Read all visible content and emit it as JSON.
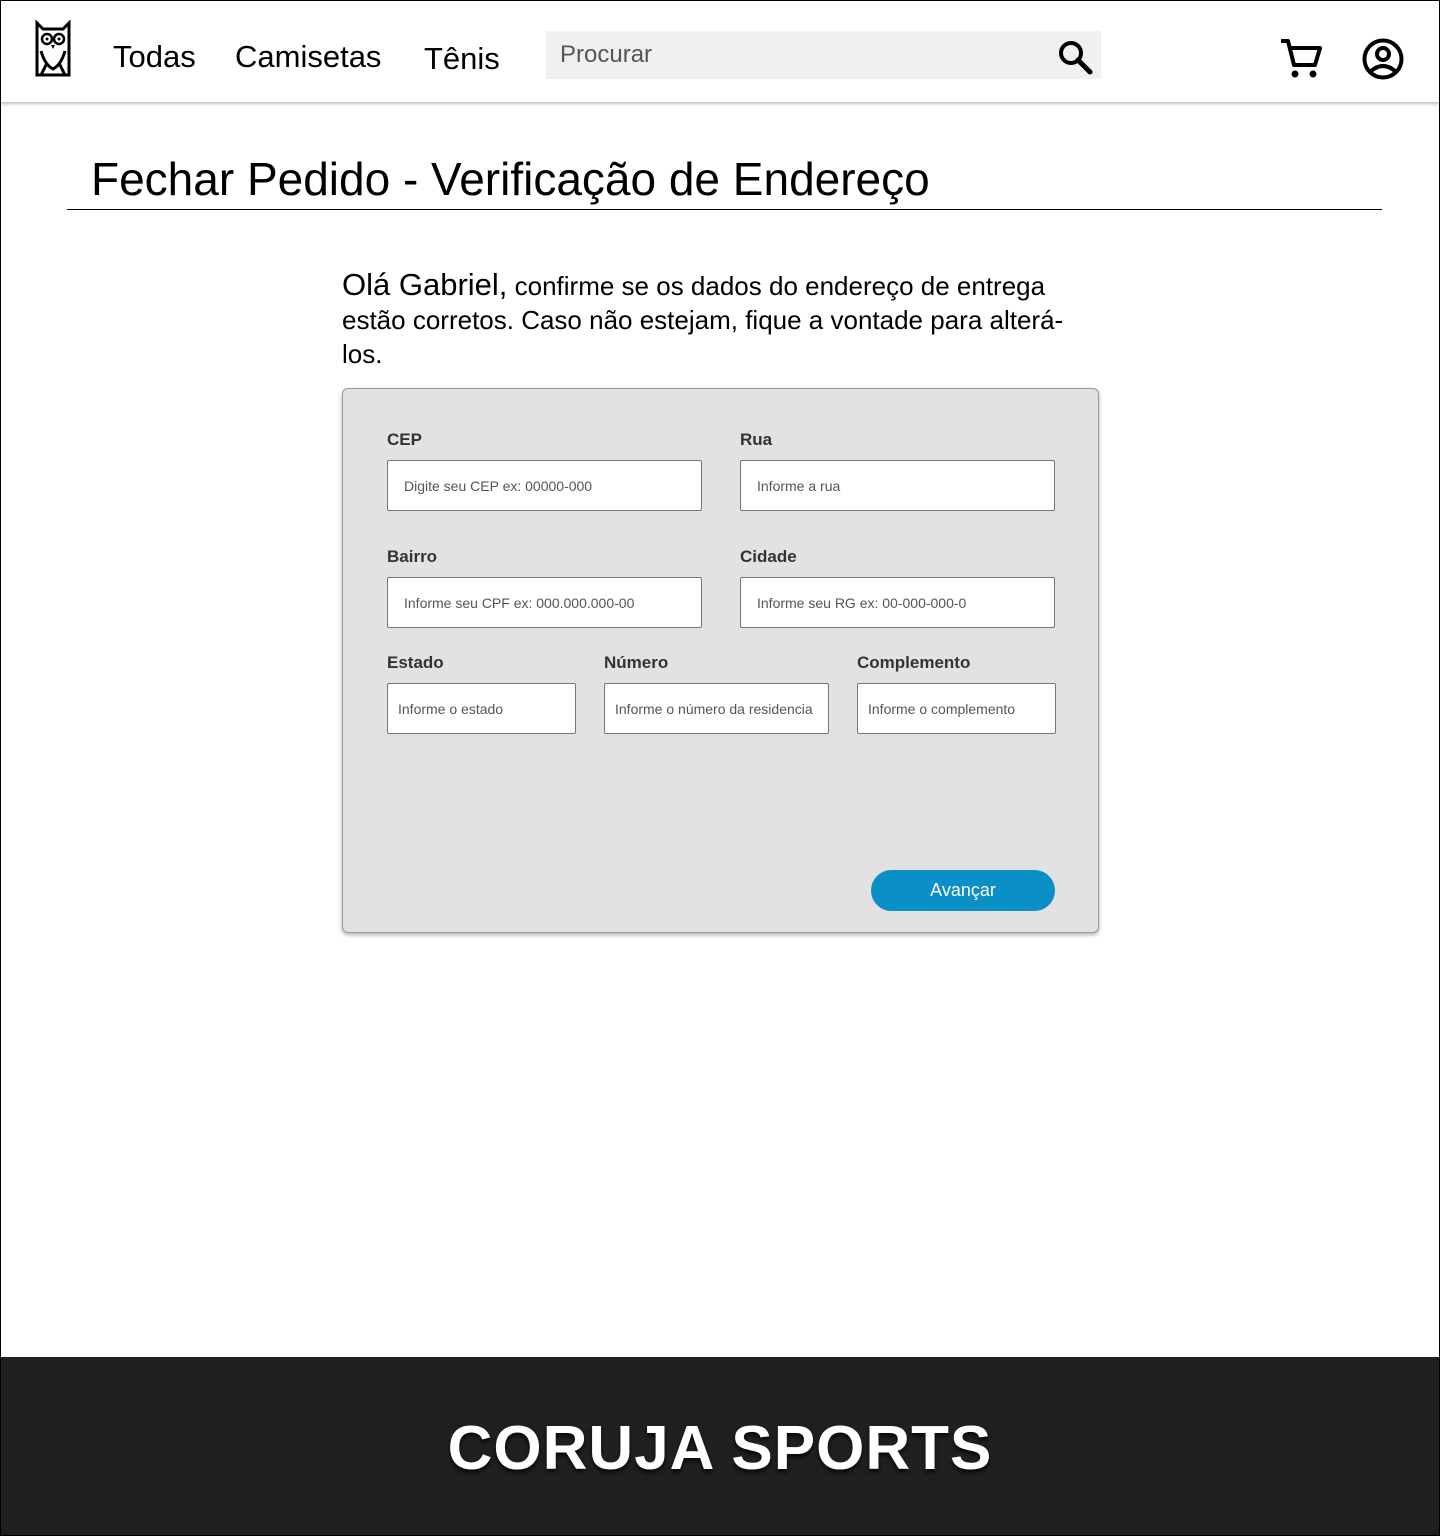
{
  "header": {
    "logo_icon": "owl-logo-icon",
    "nav": [
      {
        "label": "Todas"
      },
      {
        "label": "Camisetas"
      },
      {
        "label": "Tênis"
      }
    ],
    "search": {
      "placeholder": "Procurar",
      "icon": "search-icon"
    },
    "cart_icon": "cart-icon",
    "account_icon": "account-icon"
  },
  "main": {
    "title": "Fechar Pedido - Verificação de Endereço",
    "intro_greeting": "Olá Gabriel,",
    "intro_text": " confirme se os dados do endereço de entrega estão corretos. Caso não estejam, fique a vontade para alterá- los."
  },
  "form": {
    "cep": {
      "label": "CEP",
      "placeholder": "Digite seu CEP ex: 00000-000"
    },
    "rua": {
      "label": "Rua",
      "placeholder": "Informe a rua"
    },
    "bairro": {
      "label": "Bairro",
      "placeholder": "Informe seu CPF ex: 000.000.000-00"
    },
    "cidade": {
      "label": "Cidade",
      "placeholder": "Informe seu RG ex: 00-000-000-0"
    },
    "estado": {
      "label": "Estado",
      "placeholder": "Informe o estado"
    },
    "numero": {
      "label": "Número",
      "placeholder": "Informe o número da residencia"
    },
    "complemento": {
      "label": "Complemento",
      "placeholder": "Informe o complemento"
    },
    "submit_label": "Avançar",
    "submit_color": "#0a8fc6"
  },
  "footer": {
    "brand": "CORUJA SPORTS"
  }
}
